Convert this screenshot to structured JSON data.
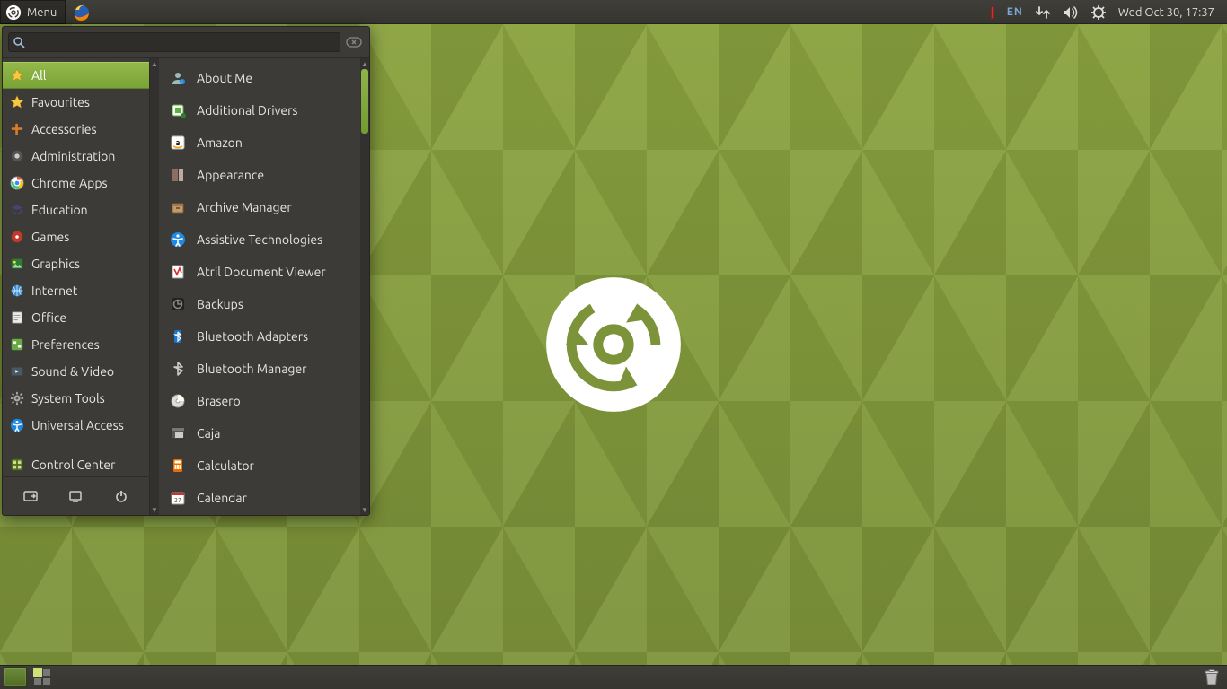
{
  "panel": {
    "menu_label": "Menu",
    "lang": "EN",
    "clock": "Wed Oct 30, 17:37"
  },
  "search": {
    "placeholder": ""
  },
  "categories": [
    {
      "label": "All",
      "icon": "star-icon",
      "selected": true
    },
    {
      "label": "Favourites",
      "icon": "star-icon"
    },
    {
      "label": "Accessories",
      "icon": "accessories-icon"
    },
    {
      "label": "Administration",
      "icon": "admin-icon"
    },
    {
      "label": "Chrome Apps",
      "icon": "chrome-icon"
    },
    {
      "label": "Education",
      "icon": "education-icon"
    },
    {
      "label": "Games",
      "icon": "games-icon"
    },
    {
      "label": "Graphics",
      "icon": "graphics-icon"
    },
    {
      "label": "Internet",
      "icon": "globe-icon"
    },
    {
      "label": "Office",
      "icon": "office-icon"
    },
    {
      "label": "Preferences",
      "icon": "preferences-icon"
    },
    {
      "label": "Sound & Video",
      "icon": "multimedia-icon"
    },
    {
      "label": "System Tools",
      "icon": "gear-icon"
    },
    {
      "label": "Universal Access",
      "icon": "accessibility-icon"
    }
  ],
  "control_center": {
    "label": "Control Center",
    "icon": "control-center-icon"
  },
  "bottom_actions": {
    "lock": "lock-screen-button",
    "logout": "logout-button",
    "power": "power-button"
  },
  "apps": [
    {
      "label": "About Me",
      "icon": "person-icon"
    },
    {
      "label": "Additional Drivers",
      "icon": "drivers-icon"
    },
    {
      "label": "Amazon",
      "icon": "amazon-icon"
    },
    {
      "label": "Appearance",
      "icon": "appearance-icon"
    },
    {
      "label": "Archive Manager",
      "icon": "archive-icon"
    },
    {
      "label": "Assistive Technologies",
      "icon": "accessibility-icon"
    },
    {
      "label": "Atril Document Viewer",
      "icon": "atril-icon"
    },
    {
      "label": "Backups",
      "icon": "backup-icon"
    },
    {
      "label": "Bluetooth Adapters",
      "icon": "bluetooth-device-icon"
    },
    {
      "label": "Bluetooth Manager",
      "icon": "bluetooth-icon"
    },
    {
      "label": "Brasero",
      "icon": "disc-icon"
    },
    {
      "label": "Caja",
      "icon": "file-manager-icon"
    },
    {
      "label": "Calculator",
      "icon": "calculator-icon"
    },
    {
      "label": "Calendar",
      "icon": "calendar-icon"
    }
  ],
  "calendar_day": "27"
}
